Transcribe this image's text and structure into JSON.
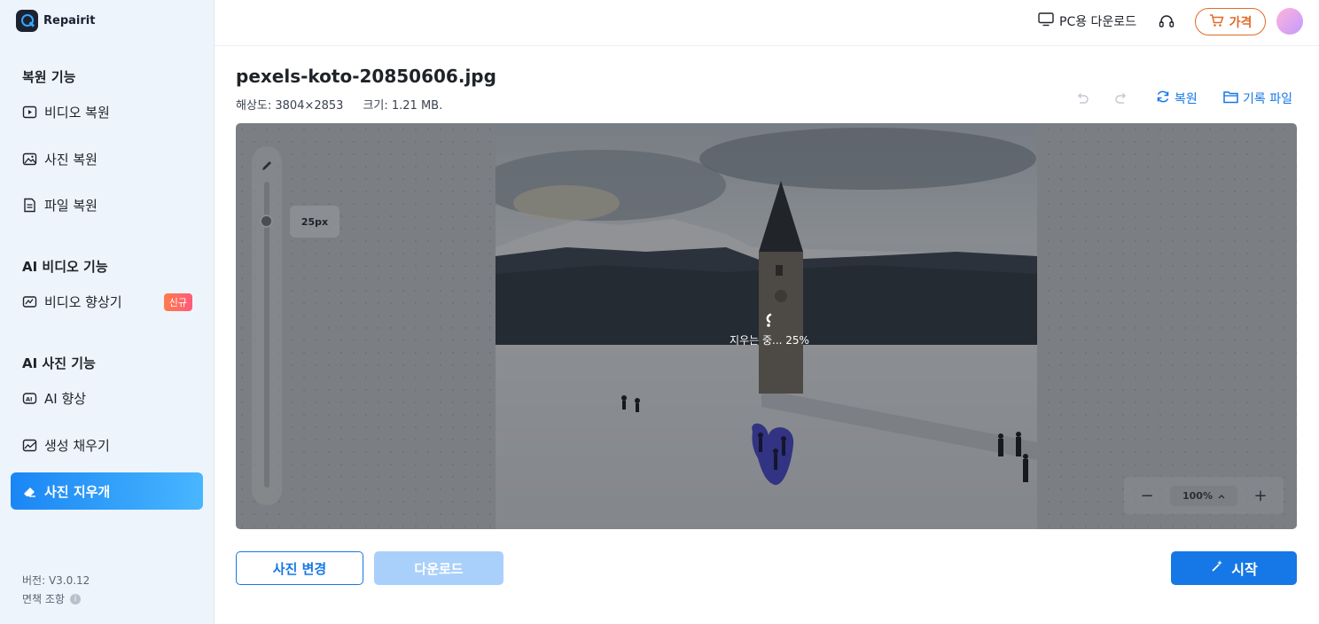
{
  "app": {
    "name": "Repairit"
  },
  "sidebar": {
    "sections": [
      {
        "title": "복원 기능"
      },
      {
        "title": "AI 비디오 기능"
      },
      {
        "title": "AI 사진 기능"
      }
    ],
    "items": [
      {
        "label": "비디오 복원",
        "icon": "video-repair-icon"
      },
      {
        "label": "사진 복원",
        "icon": "photo-repair-icon"
      },
      {
        "label": "파일 복원",
        "icon": "file-repair-icon"
      },
      {
        "label": "비디오 향상기",
        "icon": "video-enhance-icon",
        "badge": "신규"
      },
      {
        "label": "AI 향상",
        "icon": "ai-enhance-icon"
      },
      {
        "label": "생성 채우기",
        "icon": "generative-fill-icon"
      },
      {
        "label": "사진 지우개",
        "icon": "eraser-icon",
        "active": true
      }
    ],
    "version": "버전: V3.0.12",
    "disclaimer": "면책 조항"
  },
  "topbar": {
    "download_label": "PC용 다운로드",
    "price_label": "가격"
  },
  "file": {
    "name": "pexels-koto-20850606.jpg",
    "resolution": "해상도: 3804×2853",
    "size": "크기: 1.21 MB."
  },
  "toolbar": {
    "restore_label": "복원",
    "history_label": "기록 파일"
  },
  "canvas": {
    "brush_size": "25px",
    "progress_text": "지우는 중... 25%",
    "progress_percent": 25,
    "zoom": "100%"
  },
  "buttons": {
    "change_photo": "사진 변경",
    "download": "다운로드",
    "start": "시작"
  },
  "colors": {
    "accent": "#1677e6",
    "price": "#e06a2a",
    "sidebar_bg": "#eef4fc",
    "mask": "#3b3bd6"
  }
}
